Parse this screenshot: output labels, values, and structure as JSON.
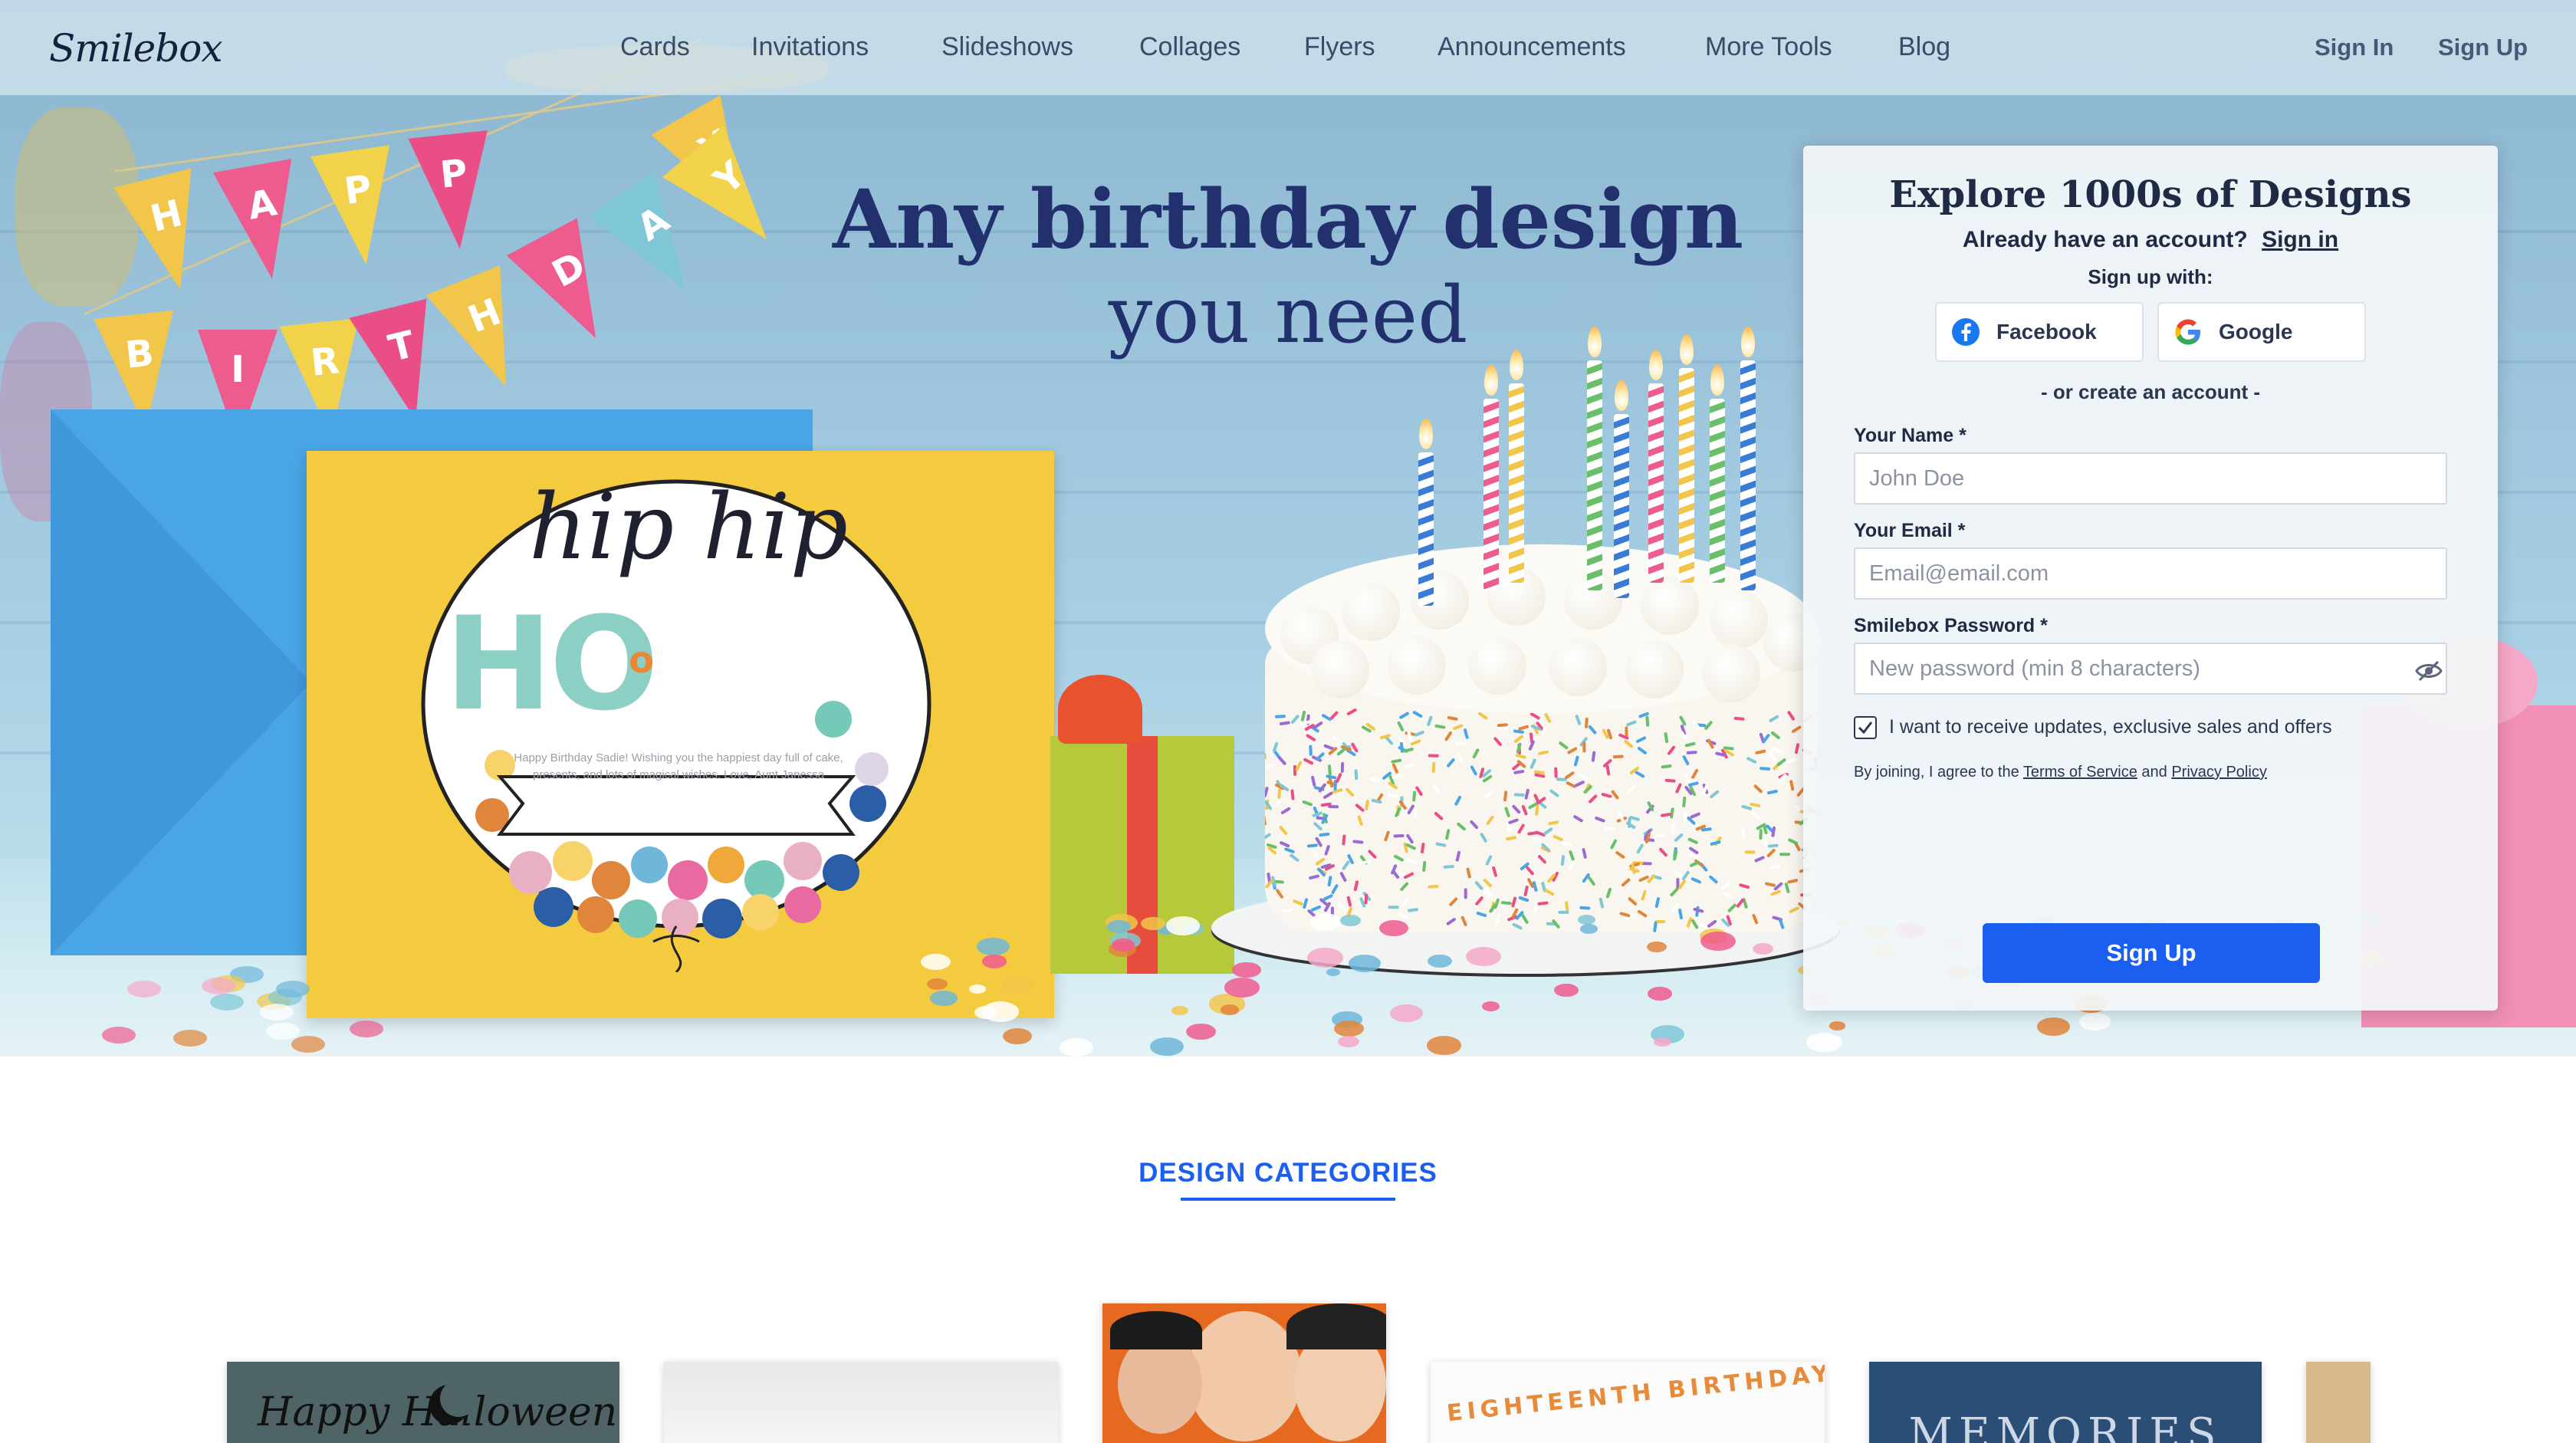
{
  "nav": {
    "logo": "Smilebox",
    "links": [
      "Cards",
      "Invitations",
      "Slideshows",
      "Collages",
      "Flyers",
      "Announcements",
      "More Tools",
      "Blog"
    ],
    "sign_in": "Sign In",
    "sign_up": "Sign Up"
  },
  "hero": {
    "headline_line1": "Any birthday design",
    "headline_line2": "you need",
    "bunting_top": [
      "H",
      "A",
      "P",
      "P",
      "Y"
    ],
    "bunting_bottom": [
      "B",
      "I",
      "R",
      "T",
      "H",
      "D",
      "A",
      "Y"
    ],
    "card": {
      "script_text": "hip hip",
      "ho_text": "HO",
      "small_o": "o",
      "message": "Happy Birthday Sadie! Wishing you the happiest day full of cake, presents, and lots of magical wishes. Love, Aunt Janessa"
    }
  },
  "signup": {
    "title": "Explore 1000s of Designs",
    "have_account": "Already have an account?",
    "sign_in_link": "Sign in",
    "sign_up_with": "Sign up with:",
    "facebook": "Facebook",
    "google": "Google",
    "or_create": "- or create an account -",
    "name_label": "Your Name *",
    "name_placeholder": "John Doe",
    "email_label": "Your Email *",
    "email_placeholder": "Email@email.com",
    "password_label": "Smilebox Password *",
    "password_placeholder": "New password (min 8 characters)",
    "updates_checkbox": "I want to receive updates, exclusive sales and offers",
    "updates_checked": true,
    "terms_prefix": "By joining, I agree to the",
    "terms_link": "Terms of Service",
    "terms_and": "and",
    "privacy_link": "Privacy Policy",
    "submit": "Sign Up"
  },
  "categories": {
    "title": "DESIGN CATEGORIES",
    "thumbnails": [
      {
        "name": "halloween",
        "text": "Happy Halloween"
      },
      {
        "name": "blank",
        "text": ""
      },
      {
        "name": "family-photo",
        "text": ""
      },
      {
        "name": "eighteenth-birthday",
        "text": "EIGHTEENTH BIRTHDAY"
      },
      {
        "name": "memories",
        "text": "MEMORIES"
      },
      {
        "name": "partial",
        "text": ""
      }
    ]
  },
  "colors": {
    "accent": "#1a5ff0",
    "headline": "#22316e",
    "card_yellow": "#f4cb3e",
    "envelope_blue": "#4aa5e6"
  }
}
